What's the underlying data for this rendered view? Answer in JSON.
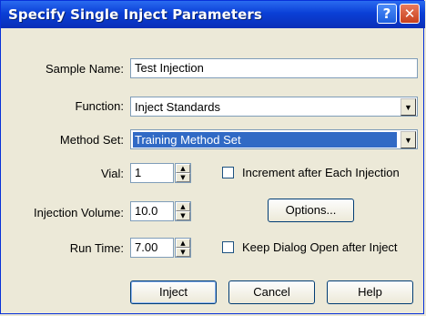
{
  "window": {
    "title": "Specify Single Inject Parameters"
  },
  "titlebar": {
    "help_glyph": "?",
    "close_glyph": "✕"
  },
  "fields": {
    "sample_name": {
      "label": "Sample Name:",
      "value": "Test Injection"
    },
    "function": {
      "label": "Function:",
      "value": "Inject Standards"
    },
    "method_set": {
      "label": "Method Set:",
      "value": "Training Method Set"
    },
    "vial": {
      "label": "Vial:",
      "value": "1"
    },
    "injection_volume": {
      "label": "Injection Volume:",
      "value": "10.0"
    },
    "run_time": {
      "label": "Run Time:",
      "value": "7.00"
    }
  },
  "checkboxes": {
    "increment": {
      "label": "Increment after Each Injection",
      "checked": false
    },
    "keep_open": {
      "label": "Keep Dialog Open after Inject",
      "checked": false
    }
  },
  "buttons": {
    "options": "Options...",
    "inject": "Inject",
    "cancel": "Cancel",
    "help": "Help"
  },
  "icons": {
    "dropdown": "chevron-down-icon",
    "spin_up": "spin-up-icon",
    "spin_down": "spin-down-icon"
  },
  "colors": {
    "titlebar": "#0a3fd6",
    "selection": "#316ac5",
    "dialog_bg": "#ece9d8"
  }
}
